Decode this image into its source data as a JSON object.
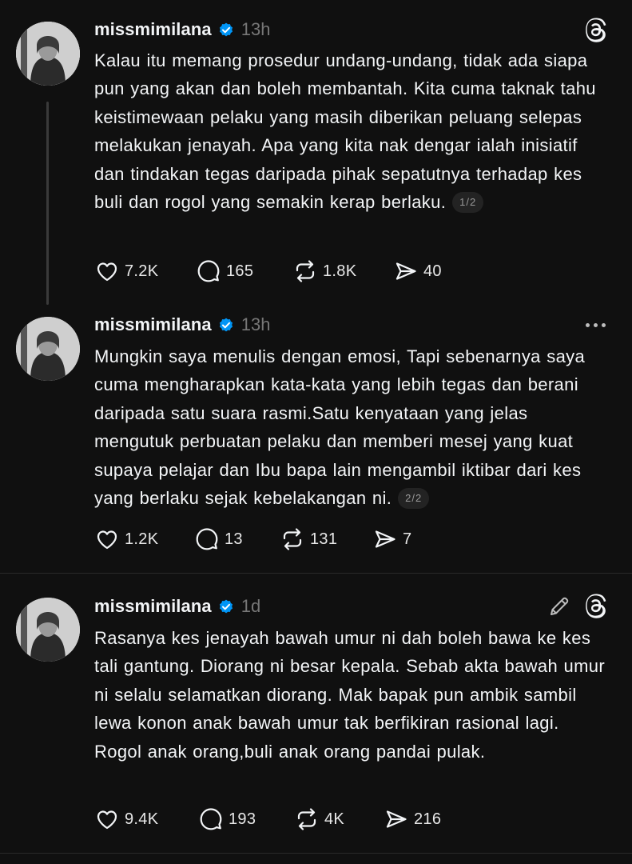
{
  "posts": [
    {
      "username": "missmimilana",
      "time": "13h",
      "text": "Kalau itu memang prosedur undang-undang, tidak ada siapa pun yang akan dan boleh membantah. Kita cuma taknak tahu keistimewaan pelaku yang masih diberikan peluang selepas melakukan jenayah. Apa yang kita nak dengar ialah inisiatif dan tindakan tegas daripada pihak sepatutnya terhadap kes buli dan rogol yang semakin kerap berlaku.",
      "pager": "1/2",
      "likes": "7.2K",
      "replies": "165",
      "reposts": "1.8K",
      "shares": "40"
    },
    {
      "username": "missmimilana",
      "time": "13h",
      "text": "Mungkin saya menulis dengan emosi, Tapi sebenarnya saya cuma mengharapkan kata-kata yang lebih tegas dan berani daripada satu suara rasmi.Satu kenyataan yang jelas mengutuk perbuatan pelaku dan memberi mesej yang kuat supaya pelajar dan Ibu bapa lain mengambil iktibar dari kes yang berlaku sejak kebelakangan ni.",
      "pager": "2/2",
      "likes": "1.2K",
      "replies": "13",
      "reposts": "131",
      "shares": "7"
    },
    {
      "username": "missmimilana",
      "time": "1d",
      "text": "Rasanya kes jenayah bawah umur ni dah boleh bawa ke kes tali gantung. Diorang ni besar kepala. Sebab akta bawah umur ni selalu selamatkan diorang. Mak bapak pun ambik sambil lewa konon anak bawah umur tak berfikiran rasional lagi. Rogol anak orang,buli anak orang pandai pulak.",
      "likes": "9.4K",
      "replies": "193",
      "reposts": "4K",
      "shares": "216"
    }
  ],
  "icons": {
    "threads_logo": "threads-icon",
    "more": "more-icon",
    "edit": "edit-icon",
    "verified": "verified-badge-icon",
    "like": "heart-icon",
    "reply": "reply-icon",
    "repost": "repost-icon",
    "share": "share-icon"
  },
  "colors": {
    "background": "#101010",
    "text": "#f3f5f7",
    "muted": "#777777",
    "verified": "#0095f6"
  }
}
